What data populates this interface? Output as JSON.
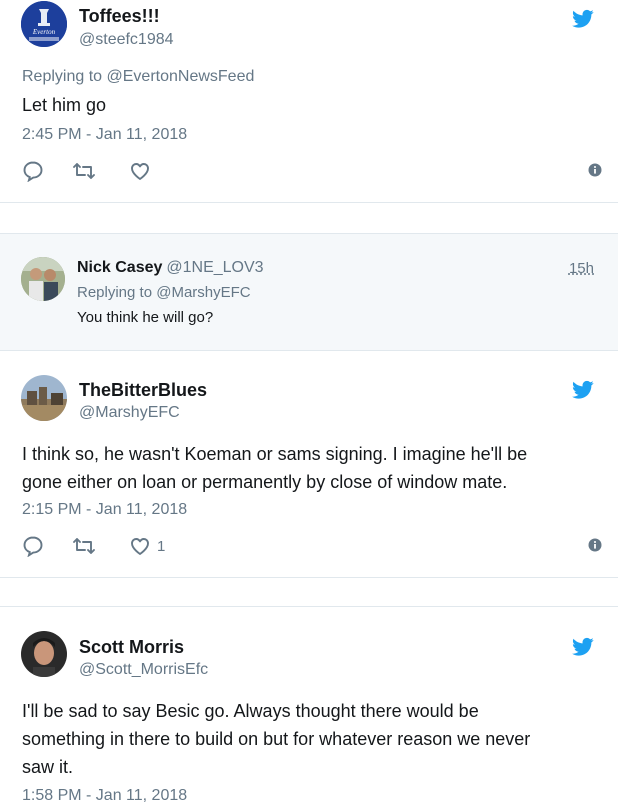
{
  "colors": {
    "accent": "#1da1f2",
    "muted": "#657786",
    "text": "#14171a",
    "border": "#e1e8ed",
    "reply_bg": "#f5f8fa"
  },
  "tweets": [
    {
      "name": "Toffees!!!",
      "handle": "@steefc1984",
      "replying_prefix": "Replying to",
      "replying_to": "@EvertonNewsFeed",
      "text": "Let him go",
      "time": "2:45 PM - Jan 11, 2018",
      "avatar_logo_text": "Everton"
    },
    {
      "name": "TheBitterBlues",
      "handle": "@MarshyEFC",
      "text_lines": [
        "I think so, he wasn't Koeman or sams signing. I imagine he'll be",
        "gone either on loan or permanently by close of window mate."
      ],
      "time": "2:15 PM - Jan 11, 2018",
      "like_count": "1"
    },
    {
      "name": "Scott Morris",
      "handle": "@Scott_MorrisEfc",
      "text_lines": [
        "I'll be sad to say Besic go. Always thought there would be",
        "something in there to build on but for whatever reason we never",
        "saw it."
      ],
      "time": "1:58 PM - Jan 11, 2018"
    }
  ],
  "reply": {
    "name": "Nick Casey",
    "handle": "@1NE_LOV3",
    "time": "15h",
    "replying_prefix": "Replying to",
    "replying_to": "@MarshyEFC",
    "text": "You think he will go?"
  },
  "icons": {
    "bird": "twitter-bird-icon",
    "reply": "reply-icon",
    "retweet": "retweet-icon",
    "like": "heart-icon",
    "info": "info-icon"
  }
}
